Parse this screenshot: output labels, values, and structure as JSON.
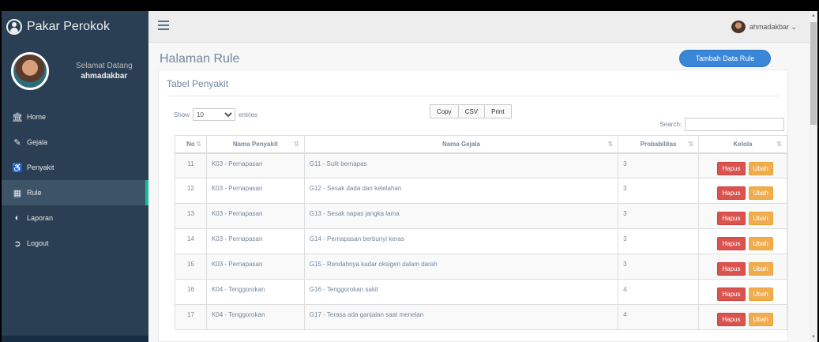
{
  "app": {
    "title": "Pakar Perokok"
  },
  "profile": {
    "welcome": "Selamat Datang",
    "username": "ahmadakbar"
  },
  "menu": [
    {
      "label": "Home",
      "icon": "bank-icon"
    },
    {
      "label": "Gejala",
      "icon": "edit-icon"
    },
    {
      "label": "Penyakit",
      "icon": "accessible-icon"
    },
    {
      "label": "Rule",
      "icon": "table-icon"
    },
    {
      "label": "Laporan",
      "icon": "chart-icon"
    },
    {
      "label": "Logout",
      "icon": "sign-out-icon"
    }
  ],
  "topbar": {
    "user": "ahmadakbar ⌄"
  },
  "page": {
    "title": "Halaman Rule",
    "add_button": "Tambah Data Rule"
  },
  "panel": {
    "title": "Tabel Penyakit",
    "show_label": "Show",
    "entries_value": "10",
    "entries_label": "entries",
    "buttons": [
      "Copy",
      "CSV",
      "Print"
    ],
    "search_label": "Search:"
  },
  "table": {
    "headers": [
      "No",
      "Nama Penyakit",
      "Nama Gejala",
      "Probabilitas",
      "Kelola"
    ],
    "rows": [
      [
        "11",
        "K03 - Pernapasan",
        "G11 - Sulit bernapas",
        "3"
      ],
      [
        "12",
        "K03 - Pernapasan",
        "G12 - Sesak dada dan kelelahan",
        "3"
      ],
      [
        "13",
        "K03 - Pernapasan",
        "G13 - Sesak napas jangka lama",
        "3"
      ],
      [
        "14",
        "K03 - Pernapasan",
        "G14 - Pernapasan berbunyi keras",
        "3"
      ],
      [
        "15",
        "K03 - Pernapasan",
        "G15 - Rendahnya kadar oksigen dalam darah",
        "3"
      ],
      [
        "16",
        "K04 - Tenggorokan",
        "G16 - Tenggorokan sakit",
        "4"
      ],
      [
        "17",
        "K04 - Tenggorokan",
        "G17 - Terasa ada ganjalan saat menelan",
        "4"
      ]
    ],
    "action_delete": "Hapus",
    "action_edit": "Ubah"
  },
  "colors": {
    "sidebar": "#2a3f54",
    "accent": "#1abb9c",
    "primary": "#3a86d8",
    "danger": "#d9534f",
    "warning": "#f0ad4e"
  }
}
